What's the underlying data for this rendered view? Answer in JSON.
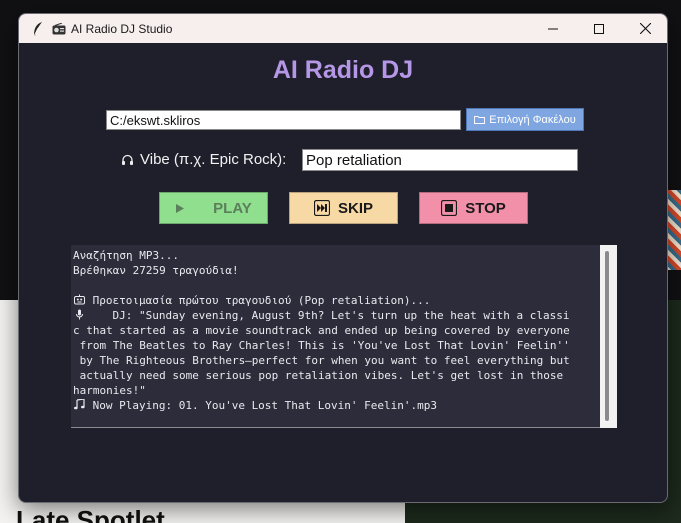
{
  "window": {
    "title": "AI Radio DJ Studio",
    "title_icon_app": "feather-icon",
    "title_icon_radio": "radio-icon",
    "controls": [
      "minimize-icon",
      "maximize-icon",
      "close-icon"
    ]
  },
  "app": {
    "heading": "AI Radio DJ",
    "folder_path": "C:/ekswt.skliros",
    "folder_button": "Επιλογή Φακέλου",
    "vibe_label": "Vibe (π.χ. Epic Rock):",
    "vibe_value": "Pop retaliation"
  },
  "controls": {
    "play": "PLAY",
    "skip": "SKIP",
    "stop": "STOP"
  },
  "log": {
    "lines": [
      "Αναζήτηση MP3...",
      "Βρέθηκαν 27259 τραγούδια!",
      "",
      " Προετοιμασία πρώτου τραγουδιού (Pop retaliation)...",
      "    DJ: \"Sunday evening, August 9th? Let's turn up the heat with a classi",
      "c that started as a movie soundtrack and ended up being covered by everyone",
      " from The Beatles to Ray Charles! This is 'You've Lost That Lovin' Feelin''",
      " by The Righteous Brothers—perfect for when you want to feel everything but",
      " actually need some serious pop retaliation vibes. Let's get lost in those",
      "harmonies!\"",
      " Now Playing: 01. You've Lost That Lovin' Feelin'.mp3"
    ],
    "line_icons": [
      "",
      "",
      "",
      "robot-icon",
      "microphone-icon",
      "",
      "",
      "",
      "",
      "",
      "music-note-icon"
    ]
  },
  "background": {
    "visible_heading_fragment": "Late Spotlet"
  },
  "colors": {
    "heading": "#b597e6",
    "play_button": "#8fdf8f",
    "skip_button": "#f7d9a6",
    "stop_button": "#f28fa9",
    "folder_button": "#7fa6e0",
    "window_bg": "#1f1e2b",
    "log_bg": "#2c2c3b"
  }
}
